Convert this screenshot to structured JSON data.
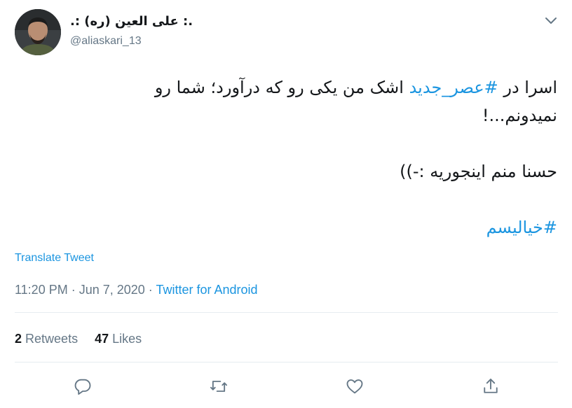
{
  "user": {
    "display_name": ".: علی العین (ره) :.",
    "handle": "@aliaskari_13"
  },
  "tweet": {
    "line1_before": "اسرا در ",
    "line1_hashtag": "#عصر_جدید",
    "line1_after": " اشک من یکی رو که درآورد؛ شما رو",
    "line2": "نمیدونم...!",
    "line3": "حسنا منم اینجوریه :-))",
    "hashtag2": "#خیالیسم"
  },
  "translate_label": "Translate Tweet",
  "meta": {
    "time": "11:20 PM",
    "separator": " · ",
    "date": "Jun 7, 2020",
    "source": "Twitter for Android"
  },
  "stats": {
    "retweets_count": "2",
    "retweets_label": "Retweets",
    "likes_count": "47",
    "likes_label": "Likes"
  },
  "icons": {
    "caret": "chevron-down-icon",
    "reply": "reply-icon",
    "retweet": "retweet-icon",
    "like": "heart-icon",
    "share": "share-icon"
  },
  "colors": {
    "link": "#1b95e0",
    "secondary_text": "#657786",
    "primary_text": "#14171a",
    "divider": "#e6ecf0"
  }
}
